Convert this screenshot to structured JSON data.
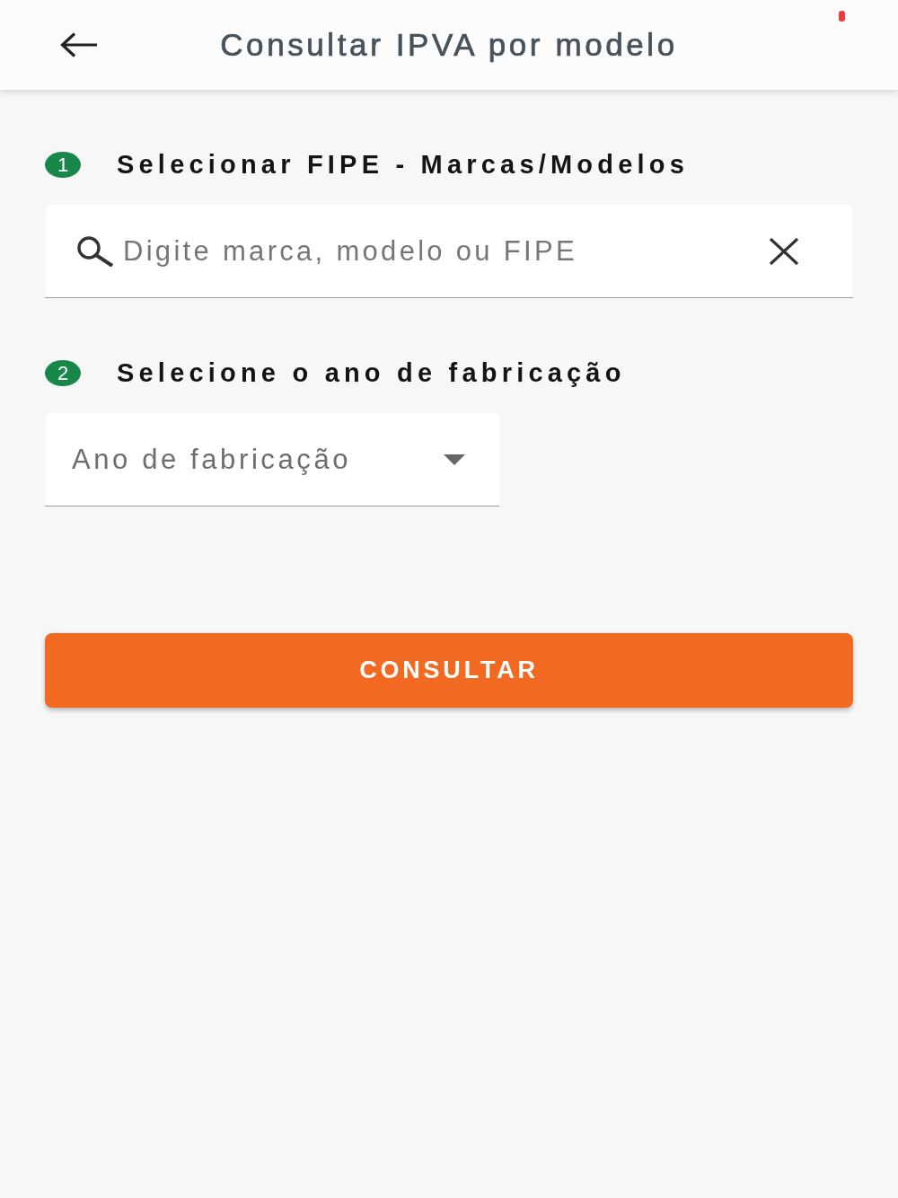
{
  "header": {
    "title": "Consultar IPVA por modelo"
  },
  "steps": [
    {
      "number": "1",
      "label": "Selecionar FIPE - Marcas/Modelos",
      "field": {
        "kind": "search",
        "placeholder": "Digite marca, modelo ou FIPE"
      }
    },
    {
      "number": "2",
      "label": "Selecione o ano de fabricação",
      "field": {
        "kind": "dropdown",
        "placeholder": "Ano de fabricação"
      }
    }
  ],
  "submit_button": {
    "label": "CONSULTAR"
  }
}
